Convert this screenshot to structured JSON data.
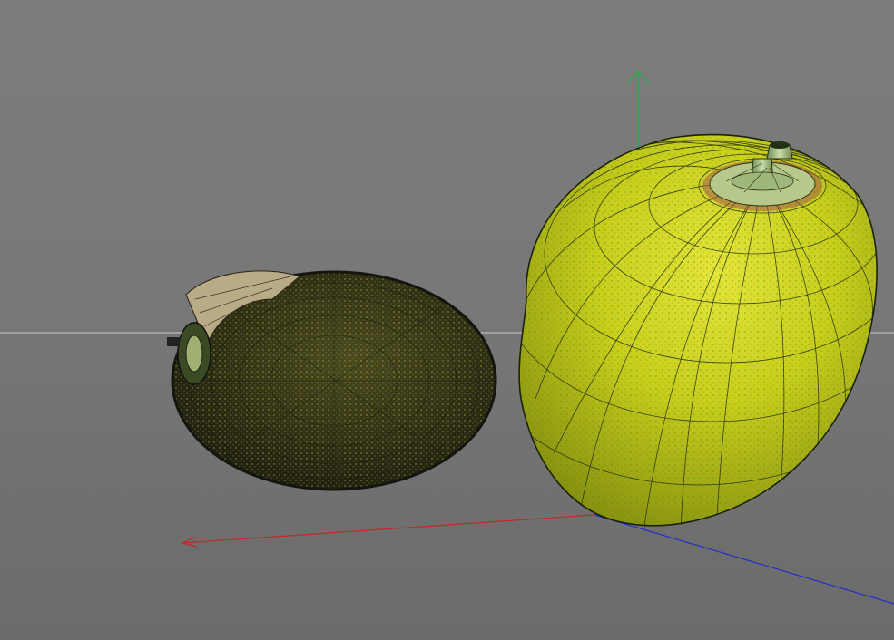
{
  "viewport": {
    "background_top": "#7c7c7c",
    "background_bottom": "#6b6b6b"
  },
  "axes": {
    "x_color": "#c0282a",
    "y_color": "#2ea84a",
    "z_color": "#2030c8",
    "horizon_color": "#c8c8c8"
  },
  "objects": [
    {
      "name": "dark-wireframe-fruit",
      "mesh_color": "#2a2a1a",
      "highlight_color": "#c9c93a"
    },
    {
      "name": "yellow-wireframe-fruit",
      "surface_color": "#c8d21a",
      "wire_color": "#1f2a10",
      "stem_color": "#9ab57a"
    }
  ]
}
